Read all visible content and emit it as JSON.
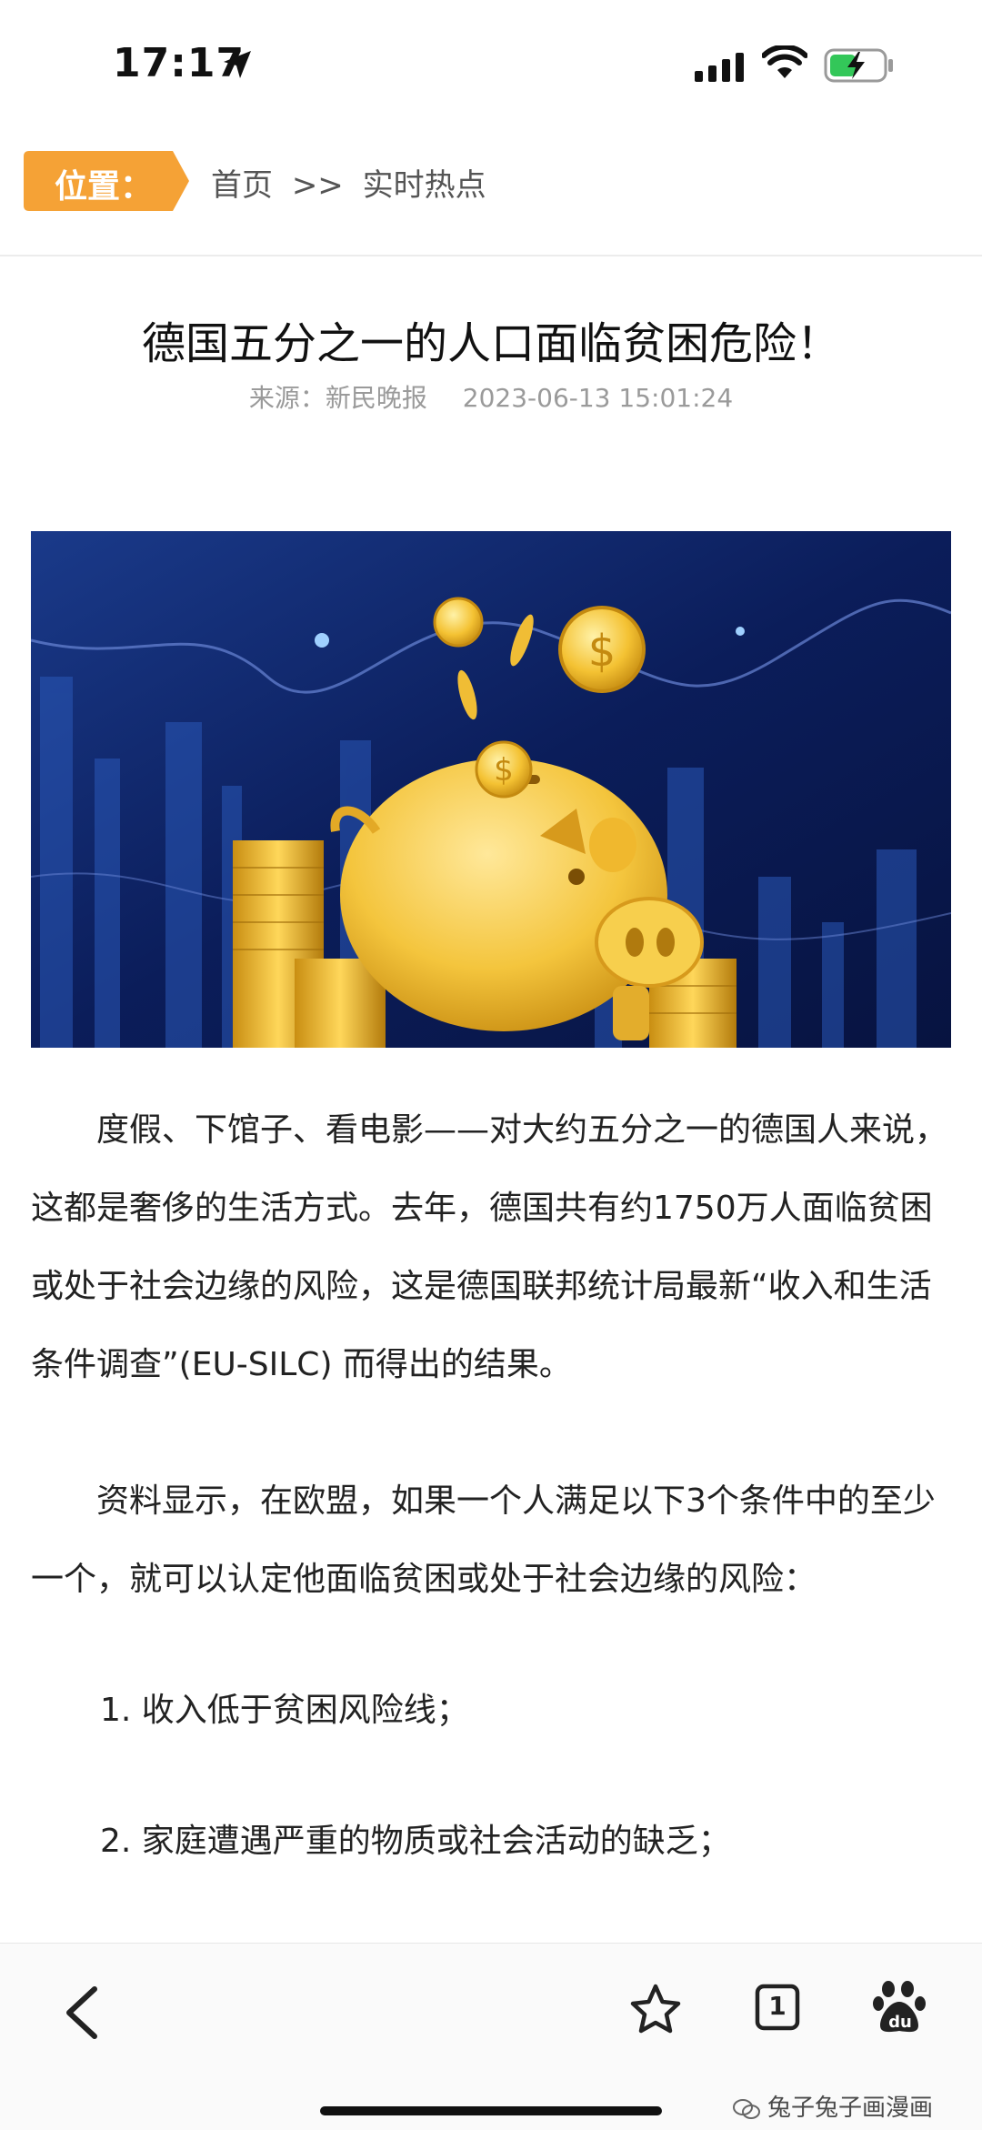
{
  "status_bar": {
    "time": "17:17"
  },
  "breadcrumb": {
    "position_label": "位置：",
    "home": "首页",
    "separator": ">>",
    "section": "实时热点"
  },
  "article": {
    "title": "德国五分之一的人口面临贫困危险！",
    "source": "来源：新民晚报",
    "datetime": "2023-06-13 15:01:24",
    "paragraphs": [
      "度假、下馆子、看电影——对大约五分之一的德国人来说，这都是奢侈的生活方式。去年，德国共有约1750万人面临贫困或处于社会边缘的风险，这是德国联邦统计局最新“收入和生活条件调查”(EU-SILC) 而得出的结果。",
      "资料显示，在欧盟，如果一个人满足以下3个条件中的至少一个，就可以认定他面临贫困或处于社会边缘的风险："
    ],
    "list_items": [
      "1. 收入低于贫困风险线；",
      "2. 家庭遭遇严重的物质或社会活动的缺乏；"
    ]
  },
  "toolbar": {
    "tab_count": "1",
    "baidu_text": "du"
  },
  "watermark": "兔子兔子画漫画",
  "colors": {
    "accent_orange": "#f5a236",
    "hero_bg": "#0b1d5a",
    "coin_gold": "#f2c230"
  }
}
